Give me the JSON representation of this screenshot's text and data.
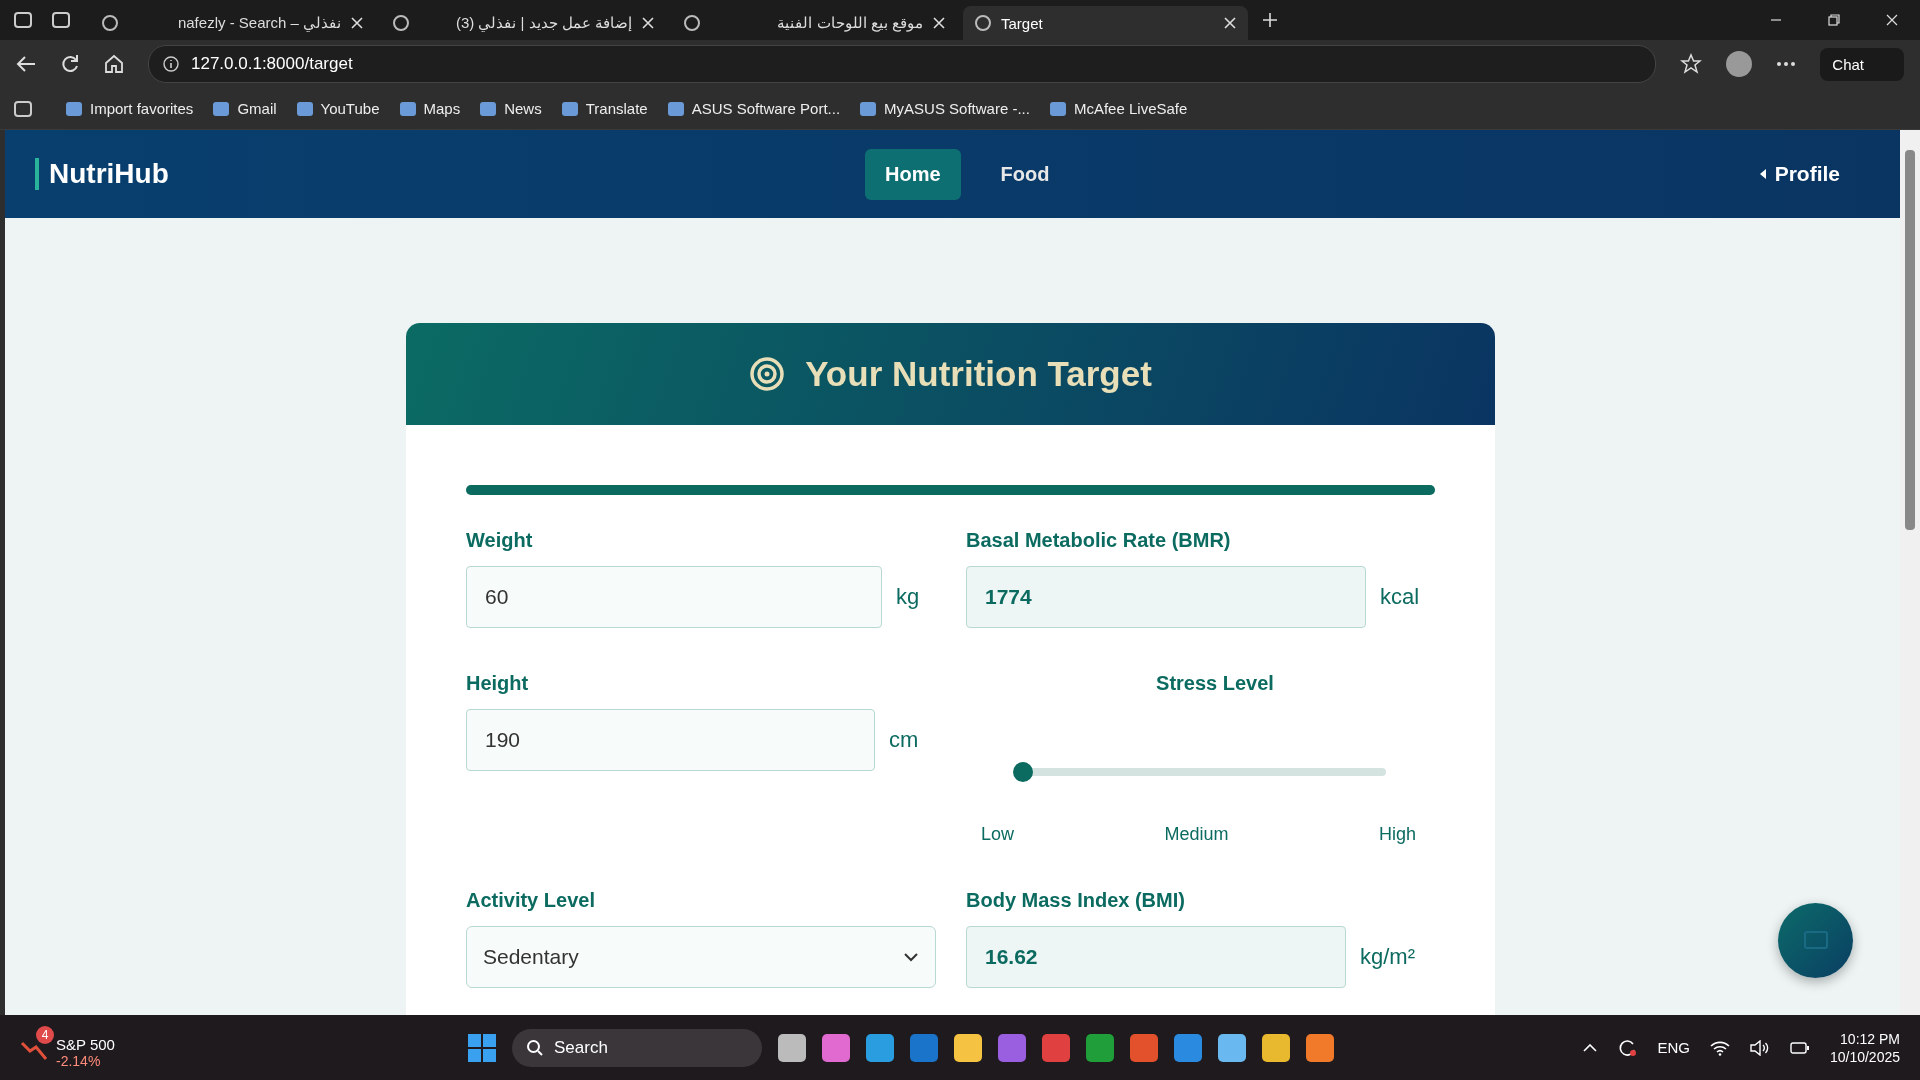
{
  "browser": {
    "tabs": [
      {
        "title": "nafezly - Search – نفذلي",
        "selected": false
      },
      {
        "title": "(3) إضافة عمل جديد | نفذلي",
        "selected": false
      },
      {
        "title": "موقع بيع اللوحات الفنية",
        "selected": false
      },
      {
        "title": "Target",
        "selected": true
      }
    ],
    "url": "127.0.0.1:8000/target",
    "chat": "Chat",
    "bookmarks": [
      "Import favorites",
      "Gmail",
      "YouTube",
      "Maps",
      "News",
      "Translate",
      "ASUS Software Port...",
      "MyASUS Software -...",
      "McAfee LiveSafe"
    ]
  },
  "navbar": {
    "brand": "NutriHub",
    "items": [
      {
        "label": "Home",
        "selected": true
      },
      {
        "label": "Food",
        "selected": false
      }
    ],
    "profile": "Profile"
  },
  "card": {
    "title": "Your Nutrition Target",
    "progress": {
      "level": 1
    },
    "weight": {
      "label": "Weight",
      "value": "60",
      "unit": "kg"
    },
    "bmr": {
      "label": "Basal Metabolic Rate (BMR)",
      "value": "1774",
      "unit": "kcal"
    },
    "height": {
      "label": "Height",
      "value": "190",
      "unit": "cm"
    },
    "stress": {
      "label": "Stress Level",
      "level": 0,
      "ticks": [
        "Low",
        "Medium",
        "High"
      ]
    },
    "activity": {
      "label": "Activity Level",
      "value": "Sedentary"
    },
    "bmi": {
      "label": "Body Mass Index (BMI)",
      "value": "16.62",
      "unit": "kg/m²"
    }
  },
  "taskbar": {
    "widget": {
      "badge": "4",
      "name": "S&P 500",
      "change": "-2.14%"
    },
    "search": "Search",
    "language": "ENG",
    "time": "10:12 PM",
    "date": "10/10/2025"
  }
}
